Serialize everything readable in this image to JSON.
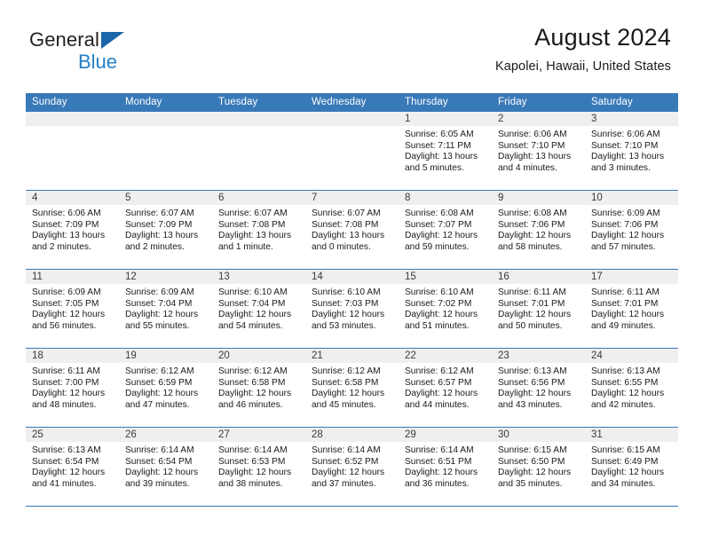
{
  "brand": {
    "name_top": "General",
    "name_bottom": "Blue",
    "triangle_color": "#1b66aa",
    "blue_color": "#2480c8"
  },
  "header": {
    "title": "August 2024",
    "subtitle": "Kapolei, Hawaii, United States"
  },
  "theme": {
    "header_blue": "#3879b8",
    "daynum_band": "#efefef",
    "text": "#1a1a1a"
  },
  "calendar": {
    "weekday_headers": [
      "Sunday",
      "Monday",
      "Tuesday",
      "Wednesday",
      "Thursday",
      "Friday",
      "Saturday"
    ],
    "weeks": [
      [
        {
          "day": "",
          "empty": true
        },
        {
          "day": "",
          "empty": true
        },
        {
          "day": "",
          "empty": true
        },
        {
          "day": "",
          "empty": true
        },
        {
          "day": "1",
          "sunrise": "Sunrise: 6:05 AM",
          "sunset": "Sunset: 7:11 PM",
          "daylight1": "Daylight: 13 hours",
          "daylight2": "and 5 minutes."
        },
        {
          "day": "2",
          "sunrise": "Sunrise: 6:06 AM",
          "sunset": "Sunset: 7:10 PM",
          "daylight1": "Daylight: 13 hours",
          "daylight2": "and 4 minutes."
        },
        {
          "day": "3",
          "sunrise": "Sunrise: 6:06 AM",
          "sunset": "Sunset: 7:10 PM",
          "daylight1": "Daylight: 13 hours",
          "daylight2": "and 3 minutes."
        }
      ],
      [
        {
          "day": "4",
          "sunrise": "Sunrise: 6:06 AM",
          "sunset": "Sunset: 7:09 PM",
          "daylight1": "Daylight: 13 hours",
          "daylight2": "and 2 minutes."
        },
        {
          "day": "5",
          "sunrise": "Sunrise: 6:07 AM",
          "sunset": "Sunset: 7:09 PM",
          "daylight1": "Daylight: 13 hours",
          "daylight2": "and 2 minutes."
        },
        {
          "day": "6",
          "sunrise": "Sunrise: 6:07 AM",
          "sunset": "Sunset: 7:08 PM",
          "daylight1": "Daylight: 13 hours",
          "daylight2": "and 1 minute."
        },
        {
          "day": "7",
          "sunrise": "Sunrise: 6:07 AM",
          "sunset": "Sunset: 7:08 PM",
          "daylight1": "Daylight: 13 hours",
          "daylight2": "and 0 minutes."
        },
        {
          "day": "8",
          "sunrise": "Sunrise: 6:08 AM",
          "sunset": "Sunset: 7:07 PM",
          "daylight1": "Daylight: 12 hours",
          "daylight2": "and 59 minutes."
        },
        {
          "day": "9",
          "sunrise": "Sunrise: 6:08 AM",
          "sunset": "Sunset: 7:06 PM",
          "daylight1": "Daylight: 12 hours",
          "daylight2": "and 58 minutes."
        },
        {
          "day": "10",
          "sunrise": "Sunrise: 6:09 AM",
          "sunset": "Sunset: 7:06 PM",
          "daylight1": "Daylight: 12 hours",
          "daylight2": "and 57 minutes."
        }
      ],
      [
        {
          "day": "11",
          "sunrise": "Sunrise: 6:09 AM",
          "sunset": "Sunset: 7:05 PM",
          "daylight1": "Daylight: 12 hours",
          "daylight2": "and 56 minutes."
        },
        {
          "day": "12",
          "sunrise": "Sunrise: 6:09 AM",
          "sunset": "Sunset: 7:04 PM",
          "daylight1": "Daylight: 12 hours",
          "daylight2": "and 55 minutes."
        },
        {
          "day": "13",
          "sunrise": "Sunrise: 6:10 AM",
          "sunset": "Sunset: 7:04 PM",
          "daylight1": "Daylight: 12 hours",
          "daylight2": "and 54 minutes."
        },
        {
          "day": "14",
          "sunrise": "Sunrise: 6:10 AM",
          "sunset": "Sunset: 7:03 PM",
          "daylight1": "Daylight: 12 hours",
          "daylight2": "and 53 minutes."
        },
        {
          "day": "15",
          "sunrise": "Sunrise: 6:10 AM",
          "sunset": "Sunset: 7:02 PM",
          "daylight1": "Daylight: 12 hours",
          "daylight2": "and 51 minutes."
        },
        {
          "day": "16",
          "sunrise": "Sunrise: 6:11 AM",
          "sunset": "Sunset: 7:01 PM",
          "daylight1": "Daylight: 12 hours",
          "daylight2": "and 50 minutes."
        },
        {
          "day": "17",
          "sunrise": "Sunrise: 6:11 AM",
          "sunset": "Sunset: 7:01 PM",
          "daylight1": "Daylight: 12 hours",
          "daylight2": "and 49 minutes."
        }
      ],
      [
        {
          "day": "18",
          "sunrise": "Sunrise: 6:11 AM",
          "sunset": "Sunset: 7:00 PM",
          "daylight1": "Daylight: 12 hours",
          "daylight2": "and 48 minutes."
        },
        {
          "day": "19",
          "sunrise": "Sunrise: 6:12 AM",
          "sunset": "Sunset: 6:59 PM",
          "daylight1": "Daylight: 12 hours",
          "daylight2": "and 47 minutes."
        },
        {
          "day": "20",
          "sunrise": "Sunrise: 6:12 AM",
          "sunset": "Sunset: 6:58 PM",
          "daylight1": "Daylight: 12 hours",
          "daylight2": "and 46 minutes."
        },
        {
          "day": "21",
          "sunrise": "Sunrise: 6:12 AM",
          "sunset": "Sunset: 6:58 PM",
          "daylight1": "Daylight: 12 hours",
          "daylight2": "and 45 minutes."
        },
        {
          "day": "22",
          "sunrise": "Sunrise: 6:12 AM",
          "sunset": "Sunset: 6:57 PM",
          "daylight1": "Daylight: 12 hours",
          "daylight2": "and 44 minutes."
        },
        {
          "day": "23",
          "sunrise": "Sunrise: 6:13 AM",
          "sunset": "Sunset: 6:56 PM",
          "daylight1": "Daylight: 12 hours",
          "daylight2": "and 43 minutes."
        },
        {
          "day": "24",
          "sunrise": "Sunrise: 6:13 AM",
          "sunset": "Sunset: 6:55 PM",
          "daylight1": "Daylight: 12 hours",
          "daylight2": "and 42 minutes."
        }
      ],
      [
        {
          "day": "25",
          "sunrise": "Sunrise: 6:13 AM",
          "sunset": "Sunset: 6:54 PM",
          "daylight1": "Daylight: 12 hours",
          "daylight2": "and 41 minutes."
        },
        {
          "day": "26",
          "sunrise": "Sunrise: 6:14 AM",
          "sunset": "Sunset: 6:54 PM",
          "daylight1": "Daylight: 12 hours",
          "daylight2": "and 39 minutes."
        },
        {
          "day": "27",
          "sunrise": "Sunrise: 6:14 AM",
          "sunset": "Sunset: 6:53 PM",
          "daylight1": "Daylight: 12 hours",
          "daylight2": "and 38 minutes."
        },
        {
          "day": "28",
          "sunrise": "Sunrise: 6:14 AM",
          "sunset": "Sunset: 6:52 PM",
          "daylight1": "Daylight: 12 hours",
          "daylight2": "and 37 minutes."
        },
        {
          "day": "29",
          "sunrise": "Sunrise: 6:14 AM",
          "sunset": "Sunset: 6:51 PM",
          "daylight1": "Daylight: 12 hours",
          "daylight2": "and 36 minutes."
        },
        {
          "day": "30",
          "sunrise": "Sunrise: 6:15 AM",
          "sunset": "Sunset: 6:50 PM",
          "daylight1": "Daylight: 12 hours",
          "daylight2": "and 35 minutes."
        },
        {
          "day": "31",
          "sunrise": "Sunrise: 6:15 AM",
          "sunset": "Sunset: 6:49 PM",
          "daylight1": "Daylight: 12 hours",
          "daylight2": "and 34 minutes."
        }
      ]
    ]
  }
}
